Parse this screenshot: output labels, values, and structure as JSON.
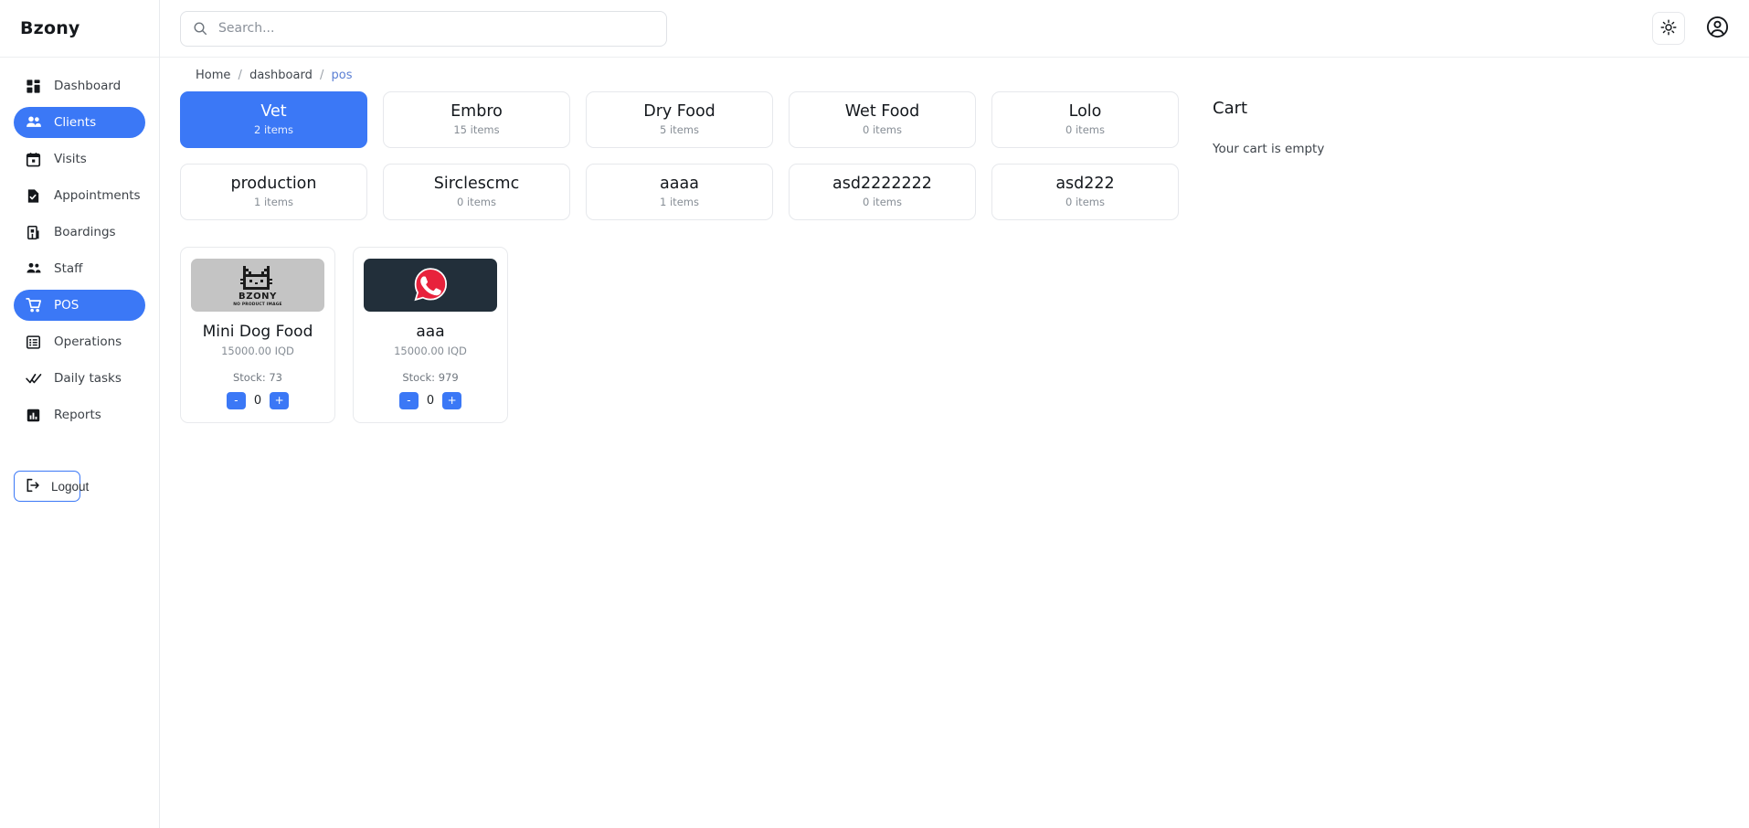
{
  "brand": {
    "name": "Bzony"
  },
  "sidebar": {
    "items": [
      {
        "label": "Dashboard",
        "icon": "dashboard-icon",
        "active": false
      },
      {
        "label": "Clients",
        "icon": "people-icon",
        "active": true
      },
      {
        "label": "Visits",
        "icon": "calendar-icon",
        "active": false
      },
      {
        "label": "Appointments",
        "icon": "file-check-icon",
        "active": false
      },
      {
        "label": "Boardings",
        "icon": "building-icon",
        "active": false
      },
      {
        "label": "Staff",
        "icon": "people-icon",
        "active": false
      },
      {
        "label": "POS",
        "icon": "shopping-cart-icon",
        "active": true
      },
      {
        "label": "Operations",
        "icon": "list-icon",
        "active": false
      },
      {
        "label": "Daily tasks",
        "icon": "double-check-icon",
        "active": false
      },
      {
        "label": "Reports",
        "icon": "bar-chart-icon",
        "active": false
      }
    ],
    "logout": {
      "label": "Logout",
      "icon": "logout-icon"
    }
  },
  "topbar": {
    "search": {
      "placeholder": "Search...",
      "value": "",
      "icon": "search-icon"
    },
    "theme_toggle": {
      "icon": "sun-icon"
    },
    "account": {
      "icon": "user-circle-icon"
    }
  },
  "breadcrumb": {
    "home": "Home",
    "section": "dashboard",
    "current": "pos",
    "separator": "/"
  },
  "categories": [
    {
      "name": "Vet",
      "count": "2 items",
      "active": true
    },
    {
      "name": "Embro",
      "count": "15 items",
      "active": false
    },
    {
      "name": "Dry Food",
      "count": "5 items",
      "active": false
    },
    {
      "name": "Wet Food",
      "count": "0 items",
      "active": false
    },
    {
      "name": "Lolo",
      "count": "0 items",
      "active": false
    },
    {
      "name": "production",
      "count": "1 items",
      "active": false
    },
    {
      "name": "Sirclescmc",
      "count": "0 items",
      "active": false
    },
    {
      "name": "aaaa",
      "count": "1 items",
      "active": false
    },
    {
      "name": "asd2222222",
      "count": "0 items",
      "active": false
    },
    {
      "name": "asd222",
      "count": "0 items",
      "active": false
    }
  ],
  "products": [
    {
      "name": "Mini Dog Food",
      "price": "15000.00 IQD",
      "stock": "Stock: 73",
      "quantity": "0",
      "image_kind": "placeholder",
      "image_text": {
        "logo": "BZONY",
        "caption": "NO PRODUCT IMAGE"
      },
      "decrement_label": "-",
      "increment_label": "+"
    },
    {
      "name": "aaa",
      "price": "15000.00 IQD",
      "stock": "Stock: 979",
      "quantity": "0",
      "image_kind": "logo",
      "image_text": {
        "logo": "",
        "caption": ""
      },
      "decrement_label": "-",
      "increment_label": "+"
    }
  ],
  "cart": {
    "title": "Cart",
    "empty_message": "Your cart is empty"
  },
  "colors": {
    "accent": "#3b78f6",
    "placeholder_bg": "#c4c4c4",
    "dark_tile_bg": "#222f3a",
    "logo_red": "#e8223c",
    "text": "#14181d",
    "muted": "#868d95"
  }
}
